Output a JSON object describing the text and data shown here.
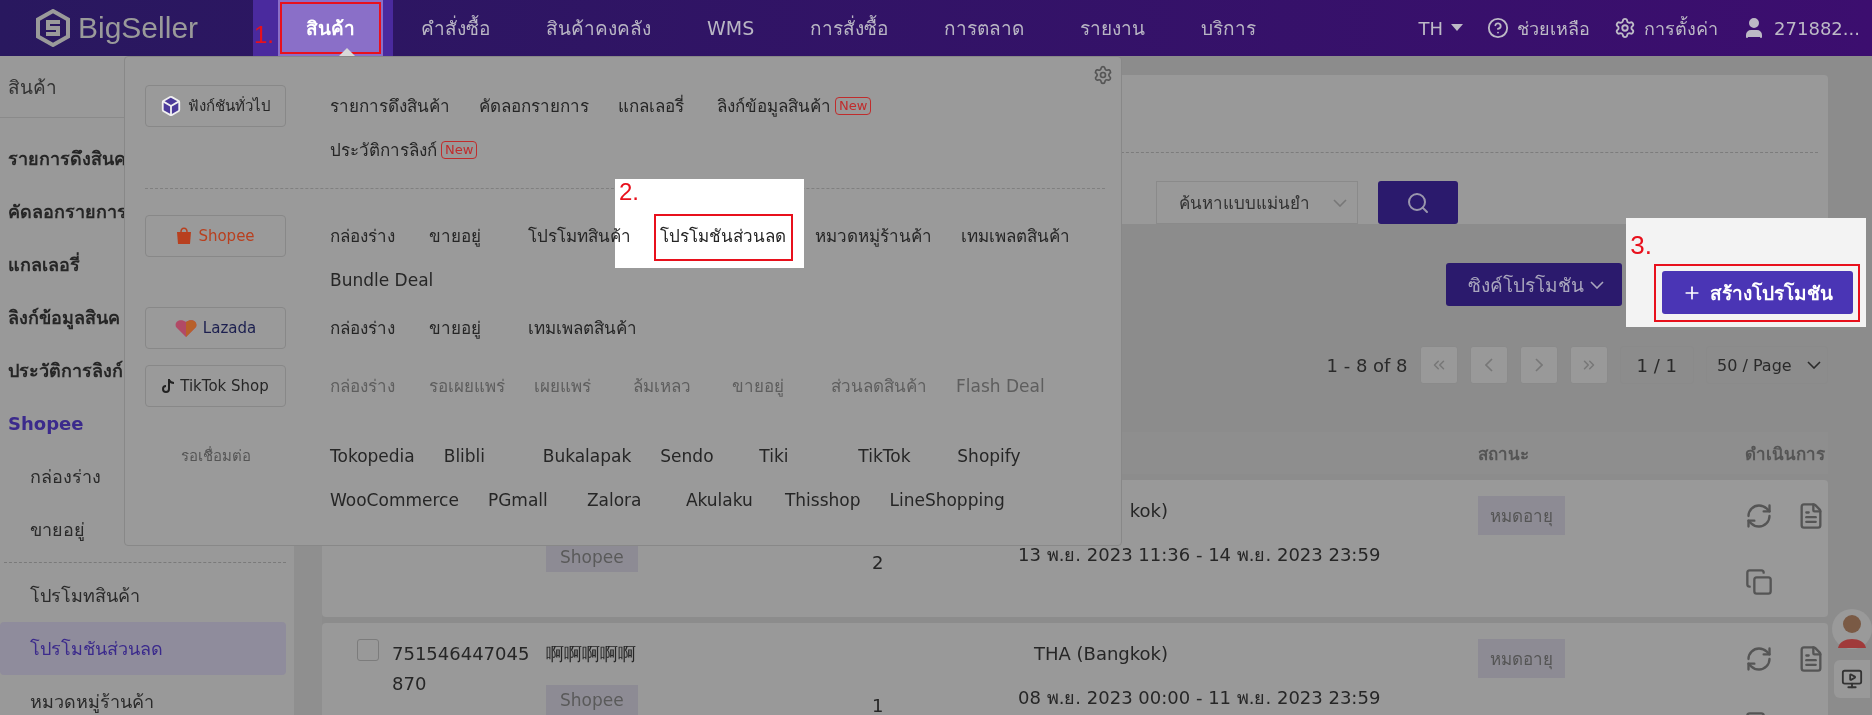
{
  "nav": {
    "logo": "BigSeller",
    "items": [
      {
        "label": "สินค้า",
        "selected": true,
        "step": "1."
      },
      {
        "label": "คำสั่งซื้อ",
        "selected": false
      },
      {
        "label": "สินค้าคงคลัง",
        "selected": false
      },
      {
        "label": "WMS",
        "selected": false
      },
      {
        "label": "การสั่งซื้อ",
        "selected": false
      },
      {
        "label": "การตลาด",
        "selected": false
      },
      {
        "label": "รายงาน",
        "selected": false
      },
      {
        "label": "บริการ",
        "selected": false
      }
    ],
    "language": "TH",
    "help": "ช่วยเหลือ",
    "settings": "การตั้งค่า",
    "user": "271882..."
  },
  "sidebar": {
    "title": "สินค้า",
    "items": [
      {
        "label": "รายการดึงสินค",
        "kind": "link",
        "selected": false
      },
      {
        "label": "คัดลอกรายการ",
        "kind": "link",
        "selected": false
      },
      {
        "label": "แกลเลอรี่",
        "kind": "link",
        "selected": false
      },
      {
        "label": "ลิงก์ข้อมูลสินค",
        "kind": "link",
        "selected": false
      },
      {
        "label": "ประวัติการลิงก์",
        "kind": "link",
        "selected": false
      },
      {
        "label": "Shopee",
        "kind": "group"
      },
      {
        "label": "กล่องร่าง",
        "kind": "sub",
        "selected": false
      },
      {
        "label": "ขายอยู่",
        "kind": "sub",
        "selected": false
      },
      {
        "kind": "divider"
      },
      {
        "label": "โปรโมทสินค้า",
        "kind": "sub",
        "selected": false
      },
      {
        "label": "โปรโมชันส่วนลด",
        "kind": "sub",
        "selected": true
      },
      {
        "label": "หมวดหมู่ร้านค้า",
        "kind": "sub",
        "selected": false
      }
    ]
  },
  "menu": {
    "rows": [
      {
        "platform": "ฟังก์ชันทั่วไป",
        "kind": "general",
        "disabled": false,
        "lines": [
          [
            {
              "label": "รายการดึงสินค้า"
            },
            {
              "label": "คัดลอกรายการ"
            },
            {
              "label": "แกลเลอรี่"
            },
            {
              "label": "ลิงก์ข้อมูลสินค้า",
              "badge": "New"
            }
          ],
          [
            {
              "label": "ประวัติการลิงก์",
              "badge": "New"
            }
          ]
        ]
      },
      {
        "platform": "Shopee",
        "kind": "shopee",
        "disabled": false,
        "lines": [
          [
            {
              "label": "กล่องร่าง"
            },
            {
              "label": "ขายอยู่"
            },
            {
              "label": "โปรโมทสินค้า"
            },
            {
              "label": "โปรโมชันส่วนลด",
              "step": "2."
            },
            {
              "label": "หมวดหมู่ร้านค้า"
            },
            {
              "label": "เทมเพลตสินค้า"
            }
          ],
          [
            {
              "label": "Bundle Deal"
            }
          ]
        ]
      },
      {
        "platform": "Lazada",
        "kind": "lazada",
        "disabled": false,
        "lines": [
          [
            {
              "label": "กล่องร่าง"
            },
            {
              "label": "ขายอยู่"
            },
            {
              "label": "เทมเพลตสินค้า"
            }
          ]
        ]
      },
      {
        "platform": "TikTok Shop",
        "kind": "tiktok",
        "disabled": true,
        "lines": [
          [
            {
              "label": "กล่องร่าง"
            },
            {
              "label": "รอเผยแพร่"
            },
            {
              "label": "เผยแพร่"
            },
            {
              "label": "ล้มเหลว"
            },
            {
              "label": "ขายอยู่"
            },
            {
              "label": "ส่วนลดสินค้า"
            },
            {
              "label": "Flash Deal"
            }
          ]
        ]
      },
      {
        "platform": "รอเชื่อมต่อ",
        "kind": "pending",
        "disabled": false,
        "lines": [
          [
            {
              "label": "Tokopedia"
            },
            {
              "label": "Blibli"
            },
            {
              "label": "Bukalapak"
            },
            {
              "label": "Sendo"
            },
            {
              "label": "Tiki"
            },
            {
              "label": "TikTok"
            },
            {
              "label": "Shopify"
            }
          ],
          [
            {
              "label": "WooCommerce"
            },
            {
              "label": "PGmall"
            },
            {
              "label": "Zalora"
            },
            {
              "label": "Akulaku"
            },
            {
              "label": "Thisshop"
            },
            {
              "label": "LineShopping"
            }
          ]
        ]
      }
    ]
  },
  "search": {
    "mode": "ค้นหาแบบแม่นยำ"
  },
  "toolbar": {
    "sync": "ซิงค์โปรโมชัน",
    "create": {
      "label": "สร้างโปรโมชัน",
      "step": "3."
    }
  },
  "pagination": {
    "range": "1 - 8 of 8",
    "page": "1 / 1",
    "page_size": "50 / Page"
  },
  "table": {
    "columns": [
      {
        "label": "สถานะ"
      },
      {
        "label": "ดำเนินการ"
      }
    ],
    "rows": [
      {
        "channel": "Shopee",
        "quantity": "2",
        "location": "kok)",
        "period": "13 พ.ย. 2023 11:36 - 14 พ.ย. 2023 23:59",
        "status": "หมดอายุ"
      },
      {
        "checked": false,
        "id": "751546447045870",
        "name": "啊啊啊啊啊",
        "channel": "Shopee",
        "quantity": "1",
        "location": "THA (Bangkok)",
        "period": "08 พ.ย. 2023 00:00 - 11 พ.ย. 2023 23:59",
        "status": "หมดอายุ"
      }
    ]
  }
}
